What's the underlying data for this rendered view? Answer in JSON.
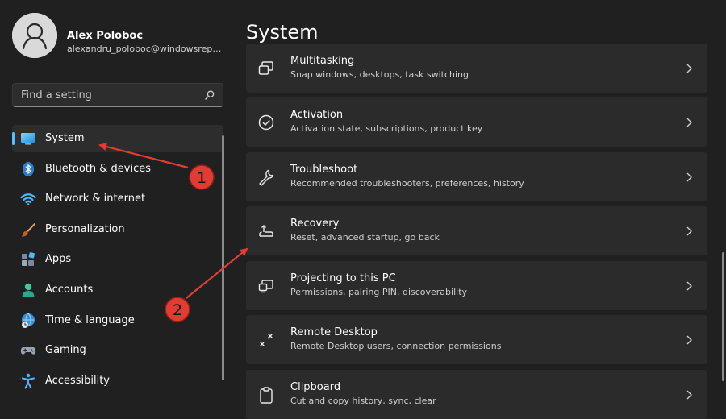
{
  "user": {
    "name": "Alex Poloboc",
    "email": "alexandru_poloboc@windowsreport..."
  },
  "search": {
    "placeholder": "Find a setting",
    "icon": "search-icon"
  },
  "nav": {
    "items": [
      {
        "label": "System",
        "icon": "system-display-icon",
        "active": true
      },
      {
        "label": "Bluetooth & devices",
        "icon": "bluetooth-icon"
      },
      {
        "label": "Network & internet",
        "icon": "wifi-icon"
      },
      {
        "label": "Personalization",
        "icon": "brush-icon"
      },
      {
        "label": "Apps",
        "icon": "apps-icon"
      },
      {
        "label": "Accounts",
        "icon": "accounts-icon"
      },
      {
        "label": "Time & language",
        "icon": "globe-clock-icon"
      },
      {
        "label": "Gaming",
        "icon": "gamepad-icon"
      },
      {
        "label": "Accessibility",
        "icon": "accessibility-icon"
      }
    ]
  },
  "main": {
    "title": "System",
    "cards": [
      {
        "title": "Multitasking",
        "subtitle": "Snap windows, desktops, task switching",
        "icon": "multitasking-icon"
      },
      {
        "title": "Activation",
        "subtitle": "Activation state, subscriptions, product key",
        "icon": "activation-check-icon"
      },
      {
        "title": "Troubleshoot",
        "subtitle": "Recommended troubleshooters, preferences, history",
        "icon": "wrench-icon"
      },
      {
        "title": "Recovery",
        "subtitle": "Reset, advanced startup, go back",
        "icon": "recovery-icon"
      },
      {
        "title": "Projecting to this PC",
        "subtitle": "Permissions, pairing PIN, discoverability",
        "icon": "projecting-icon"
      },
      {
        "title": "Remote Desktop",
        "subtitle": "Remote Desktop users, connection permissions",
        "icon": "remote-desktop-icon"
      },
      {
        "title": "Clipboard",
        "subtitle": "Cut and copy history, sync, clear",
        "icon": "clipboard-icon"
      }
    ]
  },
  "annotations": [
    {
      "label": "1"
    },
    {
      "label": "2"
    }
  ],
  "colors": {
    "background": "#202020",
    "card": "#2b2b2b",
    "accent": "#4cc2ff",
    "annotation": "#e03c31"
  }
}
